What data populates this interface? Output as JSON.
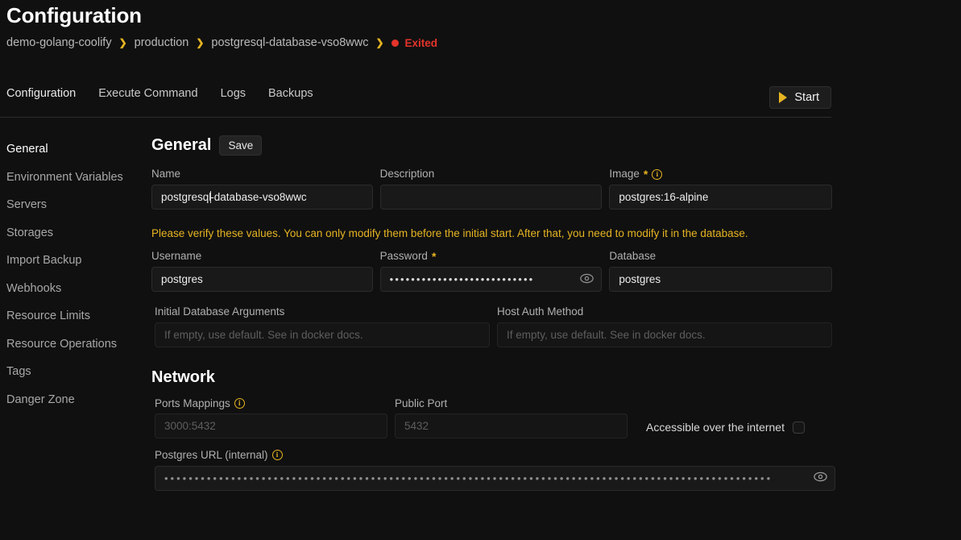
{
  "header": {
    "title": "Configuration",
    "breadcrumb": [
      {
        "label": "demo-golang-coolify"
      },
      {
        "label": "production"
      },
      {
        "label": "postgresql-database-vso8wwc"
      }
    ],
    "separator": "❯",
    "status": {
      "text": "Exited",
      "color": "#e5342a"
    }
  },
  "tabs": [
    {
      "label": "Configuration",
      "active": true
    },
    {
      "label": "Execute Command",
      "active": false
    },
    {
      "label": "Logs",
      "active": false
    },
    {
      "label": "Backups",
      "active": false
    }
  ],
  "start_button": {
    "label": "Start",
    "icon": "play-icon",
    "color": "#e6b422"
  },
  "sidebar": {
    "items": [
      {
        "label": "General",
        "active": true
      },
      {
        "label": "Environment Variables",
        "active": false
      },
      {
        "label": "Servers",
        "active": false
      },
      {
        "label": "Storages",
        "active": false
      },
      {
        "label": "Import Backup",
        "active": false
      },
      {
        "label": "Webhooks",
        "active": false
      },
      {
        "label": "Resource Limits",
        "active": false
      },
      {
        "label": "Resource Operations",
        "active": false
      },
      {
        "label": "Tags",
        "active": false
      },
      {
        "label": "Danger Zone",
        "active": false
      }
    ]
  },
  "general": {
    "heading": "General",
    "save_label": "Save",
    "name": {
      "label": "Name",
      "value": "postgresql",
      "value_rest": "-database-vso8wwc"
    },
    "description": {
      "label": "Description",
      "value": "",
      "placeholder": ""
    },
    "image": {
      "label": "Image",
      "required": "*",
      "info": "i",
      "value": "postgres:16-alpine"
    },
    "warning": "Please verify these values. You can only modify them before the initial start. After that, you need to modify it in the database.",
    "username": {
      "label": "Username",
      "value": "postgres"
    },
    "password": {
      "label": "Password",
      "required": "*",
      "value": "•••••••••••••••••••••••••••",
      "toggle_icon": "eye-icon"
    },
    "database": {
      "label": "Database",
      "value": "postgres"
    },
    "initial_args": {
      "label": "Initial Database Arguments",
      "value": "",
      "placeholder": "If empty, use default. See in docker docs."
    },
    "host_auth": {
      "label": "Host Auth Method",
      "value": "",
      "placeholder": "If empty, use default. See in docker docs."
    }
  },
  "network": {
    "heading": "Network",
    "ports": {
      "label": "Ports Mappings",
      "info": "i",
      "value": "",
      "placeholder": "3000:5432"
    },
    "public_port": {
      "label": "Public Port",
      "value": "",
      "placeholder": "5432"
    },
    "accessible": {
      "label": "Accessible over the internet",
      "checked": false
    },
    "postgres_url": {
      "label": "Postgres URL (internal)",
      "info": "i",
      "value": "••••••••••••••••••••••••••••••••••••••••••••••••••••••••••••••••••••••••••••••••••••••••••••••••••••",
      "toggle_icon": "eye-icon"
    }
  }
}
